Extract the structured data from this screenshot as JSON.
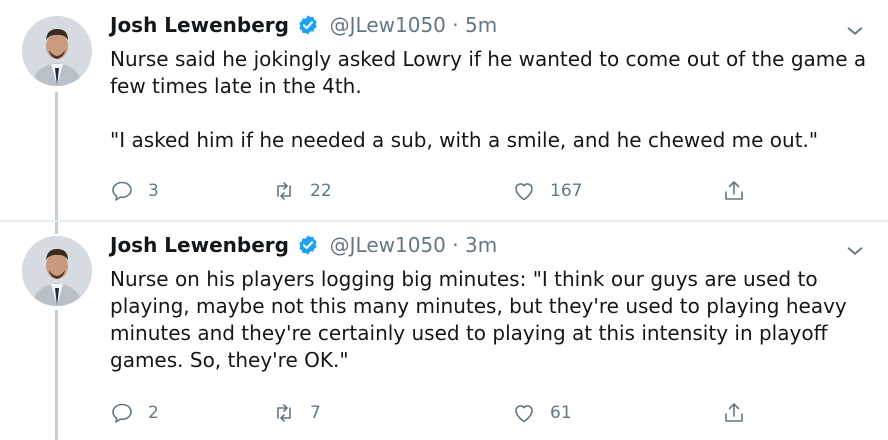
{
  "tweets": [
    {
      "author": "Josh Lewenberg",
      "handle": "@JLew1050",
      "separator": "·",
      "time": "5m",
      "text": "Nurse said he jokingly asked Lowry if he wanted to come out of the game a few times late in the 4th.\n\n\"I asked him if he needed a sub, with a smile, and he chewed me out.\"",
      "replies": "3",
      "retweets": "22",
      "likes": "167"
    },
    {
      "author": "Josh Lewenberg",
      "handle": "@JLew1050",
      "separator": "·",
      "time": "3m",
      "text": "Nurse on his players logging big minutes: \"I think our guys are used to playing, maybe not this many minutes, but they're used to playing heavy minutes and they're certainly used to playing at this intensity in playoff games. So, they're OK.\"",
      "replies": "2",
      "retweets": "7",
      "likes": "61"
    }
  ],
  "colors": {
    "verified": "#1da1f2",
    "secondary_text": "#657786",
    "thread_line": "#c4cfd6"
  },
  "icons": [
    "verified-badge-icon",
    "chevron-down-icon",
    "reply-icon",
    "retweet-icon",
    "like-icon",
    "share-icon"
  ]
}
